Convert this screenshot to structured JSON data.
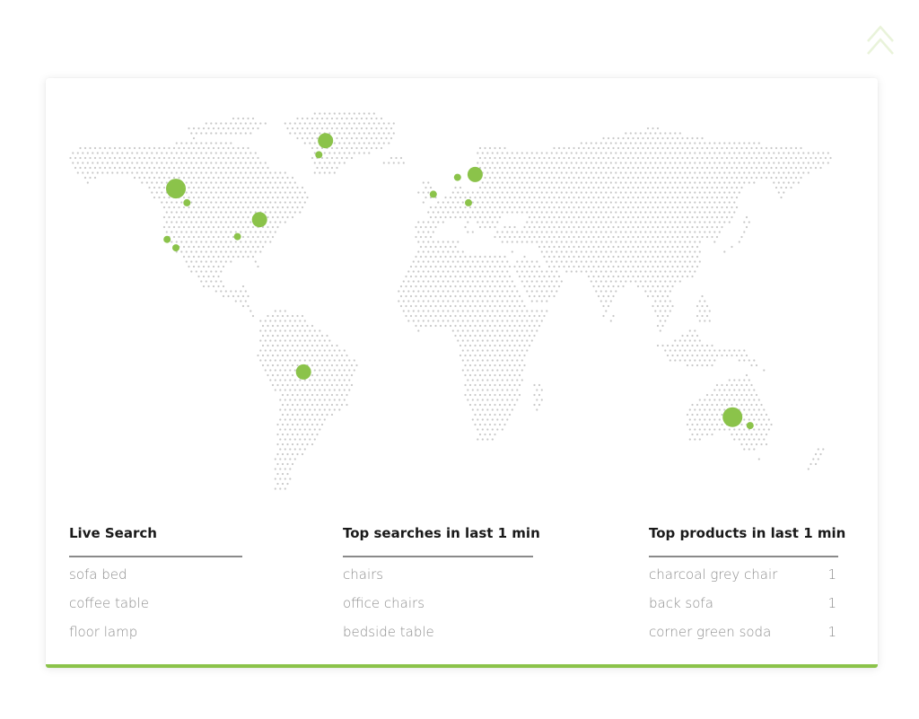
{
  "colors": {
    "accent": "#8bc34a",
    "map_dots": "#c8c8c8",
    "scroll_top": "#e9f3da"
  },
  "scroll_top_icon": "double-chevron-up-icon",
  "map": {
    "markers": [
      {
        "lon": -118,
        "lat": 55,
        "size": "large"
      },
      {
        "lon": -113,
        "lat": 50,
        "size": "small"
      },
      {
        "lon": -50,
        "lat": 72,
        "size": "medium"
      },
      {
        "lon": -53,
        "lat": 67,
        "size": "small"
      },
      {
        "lon": -80,
        "lat": 44,
        "size": "medium"
      },
      {
        "lon": -90,
        "lat": 38,
        "size": "small"
      },
      {
        "lon": -122,
        "lat": 37,
        "size": "small"
      },
      {
        "lon": -118,
        "lat": 34,
        "size": "small"
      },
      {
        "lon": -60,
        "lat": -10,
        "size": "medium"
      },
      {
        "lon": -1,
        "lat": 53,
        "size": "small"
      },
      {
        "lon": 10,
        "lat": 59,
        "size": "small"
      },
      {
        "lon": 18,
        "lat": 60,
        "size": "medium"
      },
      {
        "lon": 15,
        "lat": 50,
        "size": "small"
      },
      {
        "lon": 135,
        "lat": -26,
        "size": "large"
      },
      {
        "lon": 143,
        "lat": -29,
        "size": "small"
      }
    ]
  },
  "live_search": {
    "title": "Live Search",
    "items": [
      "sofa bed",
      "coffee table",
      "floor lamp"
    ]
  },
  "top_searches": {
    "title": "Top searches in last 1 min",
    "items": [
      "chairs",
      "office chairs",
      "bedside table"
    ]
  },
  "top_products": {
    "title": "Top products in last 1 min",
    "items": [
      {
        "name": "charcoal grey chair",
        "count": "1"
      },
      {
        "name": "back sofa",
        "count": "1"
      },
      {
        "name": "corner green soda",
        "count": "1"
      }
    ]
  }
}
